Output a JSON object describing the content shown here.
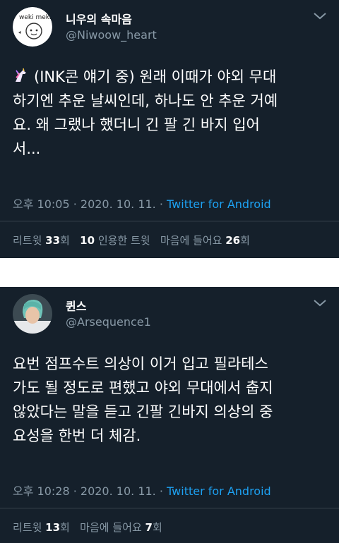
{
  "tweets": [
    {
      "name": "니우의 속마음",
      "handle": "@Niwoow_heart",
      "avatar_text": "weki meki",
      "emoji_icon": "unicorn-icon",
      "text": "(INK콘 얘기 중) 원래 이때가 야외 무대\n하기엔 추운 날씨인데, 하나도 안 추운 거예\n요. 왜 그랬나 했더니 긴 팔 긴 바지 입어\n서...",
      "time": "오후 10:05 · 2020. 10. 11. · ",
      "source": "Twitter for Android",
      "stats": [
        {
          "label": "리트윗 ",
          "value": "33",
          "suffix": "회"
        },
        {
          "label": "",
          "value": "10",
          "suffix": " 인용한 트윗"
        },
        {
          "label": "마음에 들어요 ",
          "value": "26",
          "suffix": "회"
        }
      ]
    },
    {
      "name": "퀸스",
      "handle": "@Arsequence1",
      "text": "요번 점프수트 의상이 이거 입고 필라테스\n가도 될 정도로 편했고 야외 무대에서 춥지\n않았다는 말을 듣고 긴팔 긴바지 의상의 중\n요성을 한번 더 체감.",
      "time": "오후 10:28 · 2020. 10. 11. · ",
      "source": "Twitter for Android",
      "stats": [
        {
          "label": "리트윗 ",
          "value": "13",
          "suffix": "회"
        },
        {
          "label": "마음에 들어요 ",
          "value": "7",
          "suffix": "회"
        }
      ]
    }
  ],
  "colors": {
    "background": "#15202b",
    "text": "#ffffff",
    "secondary": "#8899a6",
    "link": "#1da1f2",
    "divider": "#38444d"
  }
}
